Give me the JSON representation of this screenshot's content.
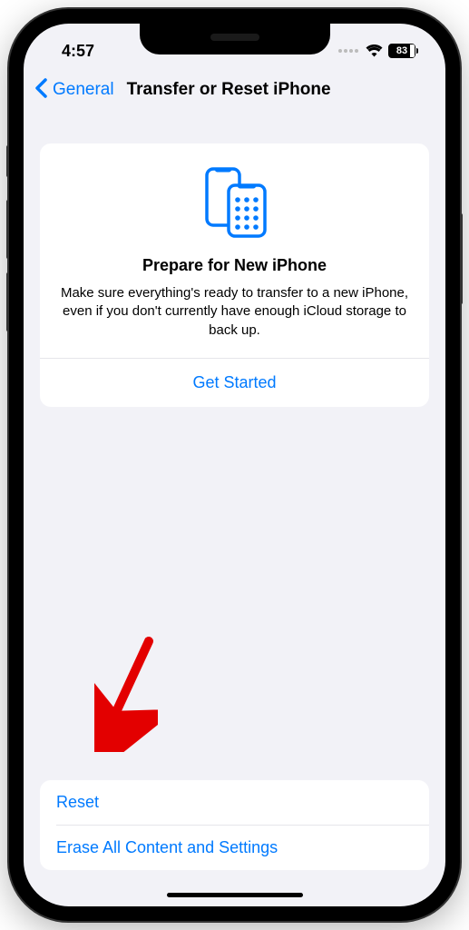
{
  "status": {
    "time": "4:57",
    "battery": "83"
  },
  "nav": {
    "back_label": "General",
    "title": "Transfer or Reset iPhone"
  },
  "prepare": {
    "title": "Prepare for New iPhone",
    "description": "Make sure everything's ready to transfer to a new iPhone, even if you don't currently have enough iCloud storage to back up.",
    "action": "Get Started"
  },
  "bottom": {
    "reset": "Reset",
    "erase": "Erase All Content and Settings"
  }
}
